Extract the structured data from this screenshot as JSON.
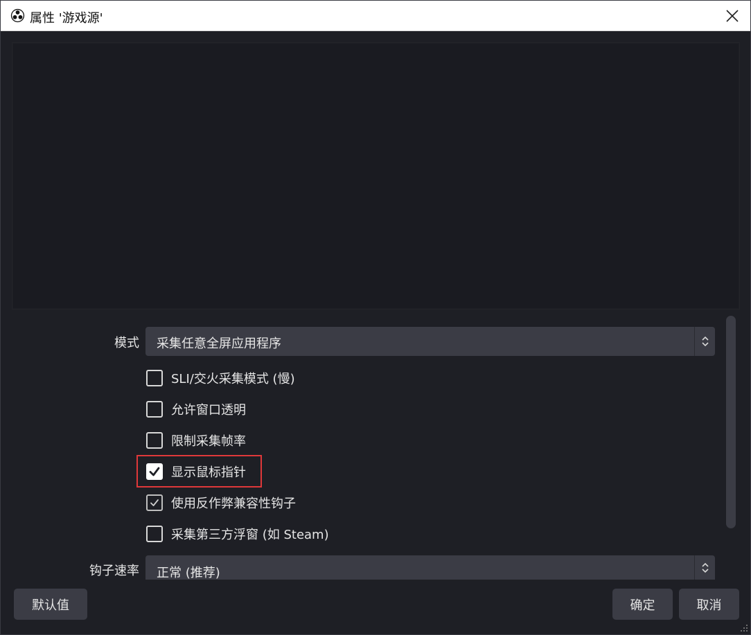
{
  "window": {
    "title": "属性 '游戏源'",
    "app_icon": "obs-logo-icon",
    "close_icon": "close-icon"
  },
  "form": {
    "mode_label": "模式",
    "mode_value": "采集任意全屏应用程序",
    "checkboxes": [
      {
        "label": "SLI/交火采集模式 (慢)",
        "checked": false
      },
      {
        "label": "允许窗口透明",
        "checked": false
      },
      {
        "label": "限制采集帧率",
        "checked": false
      },
      {
        "label": "显示鼠标指针",
        "checked": true
      },
      {
        "label": "使用反作弊兼容性钩子",
        "checked": true
      },
      {
        "label": "采集第三方浮窗 (如 Steam)",
        "checked": false
      }
    ],
    "hook_rate_label": "钩子速率",
    "hook_rate_value": "正常 (推荐)"
  },
  "buttons": {
    "defaults": "默认值",
    "ok": "确定",
    "cancel": "取消"
  },
  "colors": {
    "background": "#1e1f25",
    "control": "#3b3c45",
    "highlight": "#e0383a"
  }
}
